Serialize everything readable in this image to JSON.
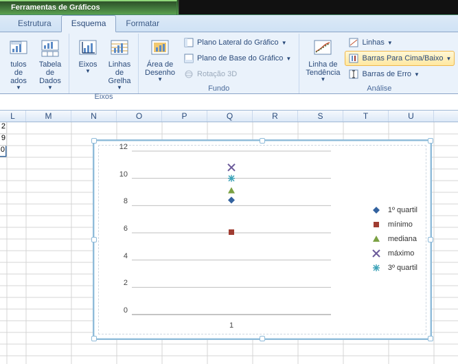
{
  "window": {
    "context_title": "Ferramentas de Gráficos"
  },
  "tabs": {
    "items": [
      "Estrutura",
      "Esquema",
      "Formatar"
    ],
    "active_index": 1
  },
  "ribbon": {
    "groups": {
      "labels": {
        "name": "",
        "items": [
          {
            "label": "tulos de\nados"
          },
          {
            "label": "Tabela de\nDados"
          }
        ]
      },
      "eixos": {
        "name": "Eixos",
        "items": [
          {
            "label": "Eixos"
          },
          {
            "label": "Linhas de\nGrelha"
          }
        ]
      },
      "fundo": {
        "name": "Fundo",
        "large": {
          "label": "Área de\nDesenho"
        },
        "small": [
          {
            "label": "Plano Lateral do Gráfico"
          },
          {
            "label": "Plano de Base do Gráfico"
          },
          {
            "label": "Rotação 3D",
            "disabled": true
          }
        ]
      },
      "analise": {
        "name": "Análise",
        "large": {
          "label": "Linha de\nTendência"
        },
        "small": [
          {
            "label": "Linhas"
          },
          {
            "label": "Barras Para Cima/Baixo",
            "highlight": true
          },
          {
            "label": "Barras de Erro"
          }
        ]
      }
    }
  },
  "sheet": {
    "columns": [
      "L",
      "M",
      "N",
      "O",
      "P",
      "Q",
      "R",
      "S",
      "T",
      "U"
    ],
    "left_values": [
      "2",
      "9",
      "0"
    ]
  },
  "chart_data": {
    "type": "scatter",
    "categories": [
      "1"
    ],
    "x": [
      1
    ],
    "series": [
      {
        "name": "1º quartil",
        "values": [
          8.4
        ],
        "marker": "diamond",
        "color": "#33629f"
      },
      {
        "name": "mínimo",
        "values": [
          6.05
        ],
        "marker": "square",
        "color": "#a03d32"
      },
      {
        "name": "mediana",
        "values": [
          9.1
        ],
        "marker": "triangle",
        "color": "#7ba143"
      },
      {
        "name": "máximo",
        "values": [
          10.8
        ],
        "marker": "x",
        "color": "#6b5a9a"
      },
      {
        "name": "3º quartil",
        "values": [
          10.0
        ],
        "marker": "asterisk",
        "color": "#3ea3b8"
      }
    ],
    "ylim": [
      0,
      12
    ],
    "yticks": [
      0,
      2,
      4,
      6,
      8,
      10,
      12
    ],
    "xlabel": "",
    "ylabel": "",
    "title": "",
    "legend_position": "right"
  }
}
